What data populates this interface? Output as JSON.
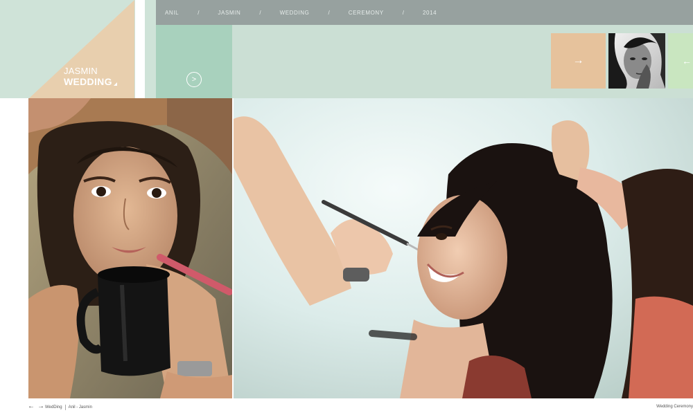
{
  "header": {
    "title_line1": "JASMIN",
    "title_line2": "WEDDING"
  },
  "breadcrumb": [
    "ANIL",
    "JASMIN",
    "WEDDING",
    "CEREMONY",
    "2014"
  ],
  "breadcrumb_separator": "/",
  "nav": {
    "next_glyph": ">",
    "thumb_next_glyph": "→",
    "thumb_prev_glyph": "←"
  },
  "footer": {
    "left_prev_glyph": "←",
    "left_next_glyph": "→",
    "left_category": "WedDing",
    "left_couple": "Anil - Jasmin",
    "right_text": "Wedding Ceremony"
  },
  "colors": {
    "mint_bg": "#cfe3d8",
    "peach": "#e6c29c",
    "breadcrumb_bar": "#97a19f",
    "side_panel": "#a8d1bd",
    "main_band": "#cbdfd4",
    "thumb_mint": "#c9e6c0"
  }
}
